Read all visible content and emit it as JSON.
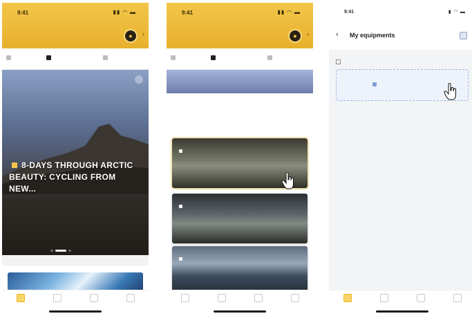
{
  "phone1": {
    "status": {
      "time": "9:41",
      "icons": "▮▮ ◠ ▬"
    },
    "header": {
      "title": "",
      "subtitle": ""
    },
    "tabs": [
      {
        "label": ""
      },
      {
        "label": ""
      },
      {
        "label": ""
      }
    ],
    "hero": {
      "title": "8-DAYS THROUGH ARCTIC BEAUTY: CYCLING FROM NEW...",
      "stats": [
        {
          "value": "",
          "label": ""
        },
        {
          "value": "",
          "label": ""
        },
        {
          "value": "",
          "label": ""
        }
      ]
    },
    "nav": [
      {
        "label": ""
      },
      {
        "label": ""
      },
      {
        "label": ""
      },
      {
        "label": ""
      }
    ]
  },
  "phone2": {
    "status": {
      "time": "9:41",
      "icons": "▮▮ ◠ ▬"
    },
    "header": {
      "title": "",
      "subtitle": ""
    },
    "tabs": [
      {
        "label": ""
      },
      {
        "label": ""
      },
      {
        "label": ""
      }
    ],
    "section_title": "",
    "filter": "",
    "routes": [
      {
        "name": "",
        "meta": ""
      },
      {
        "name": "",
        "meta": ""
      },
      {
        "name": "",
        "meta": ""
      }
    ],
    "nav": [
      {
        "label": ""
      },
      {
        "label": ""
      },
      {
        "label": ""
      },
      {
        "label": ""
      }
    ]
  },
  "phone3": {
    "status": {
      "time": "9:41",
      "icons": "▮ ◠ ▬"
    },
    "title": "My equipments",
    "section_label": "",
    "add_label": "",
    "nav": [
      {
        "label": ""
      },
      {
        "label": ""
      },
      {
        "label": ""
      },
      {
        "label": ""
      }
    ]
  },
  "colors": {
    "header_yellow": "#f2c64a",
    "accent_blue": "#5b7fc2",
    "nav_active": "#e6a516"
  },
  "icons": [
    "avatar-icon",
    "chevron-down-icon",
    "tab-icon",
    "close-icon",
    "hand-cursor-icon",
    "back-icon",
    "help-icon",
    "plus-icon",
    "home-icon",
    "routes-icon",
    "device-icon",
    "profile-icon"
  ]
}
